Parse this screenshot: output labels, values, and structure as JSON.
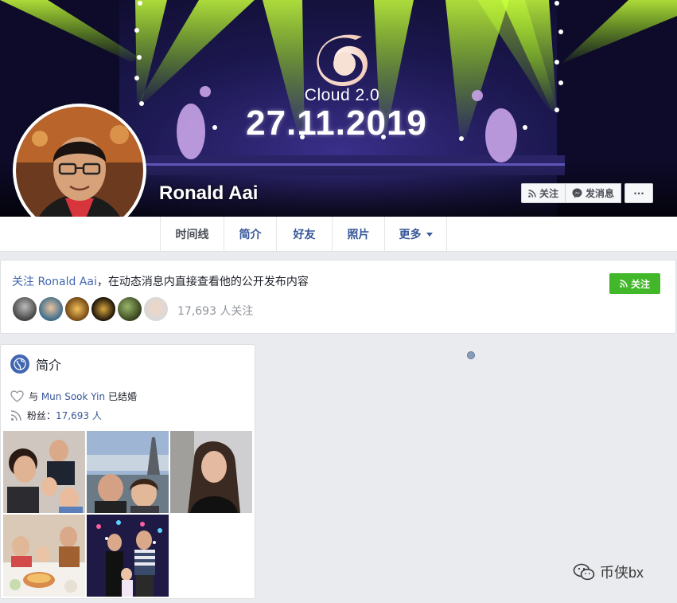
{
  "cover": {
    "brand": "Cloud 2.0",
    "date": "27.11.2019"
  },
  "profile": {
    "name": "Ronald Aai"
  },
  "actions": {
    "follow_label": "关注",
    "message_label": "发消息",
    "more_label": "···"
  },
  "tabs": [
    {
      "label": "时间线",
      "active": true
    },
    {
      "label": "简介"
    },
    {
      "label": "好友"
    },
    {
      "label": "照片"
    },
    {
      "label": "更多"
    }
  ],
  "follow_panel": {
    "prefix": "关注 ",
    "name_link": "Ronald Aai",
    "suffix": "，在动态消息内直接查看他的公开发布内容",
    "button_label": "关注",
    "follower_count": "17,693 人关注"
  },
  "intro": {
    "title": "简介",
    "married_prefix": "与 ",
    "spouse_link": "Mun Sook Yin",
    "married_suffix": " 已结婚",
    "followers_label": "粉丝：",
    "followers_value": "17,693 人"
  },
  "watermark": {
    "text": "币侠bx"
  },
  "colors": {
    "accent": "#4267b2",
    "link": "#385898",
    "follow_green": "#42b72a",
    "page_bg": "#e9ebee"
  }
}
